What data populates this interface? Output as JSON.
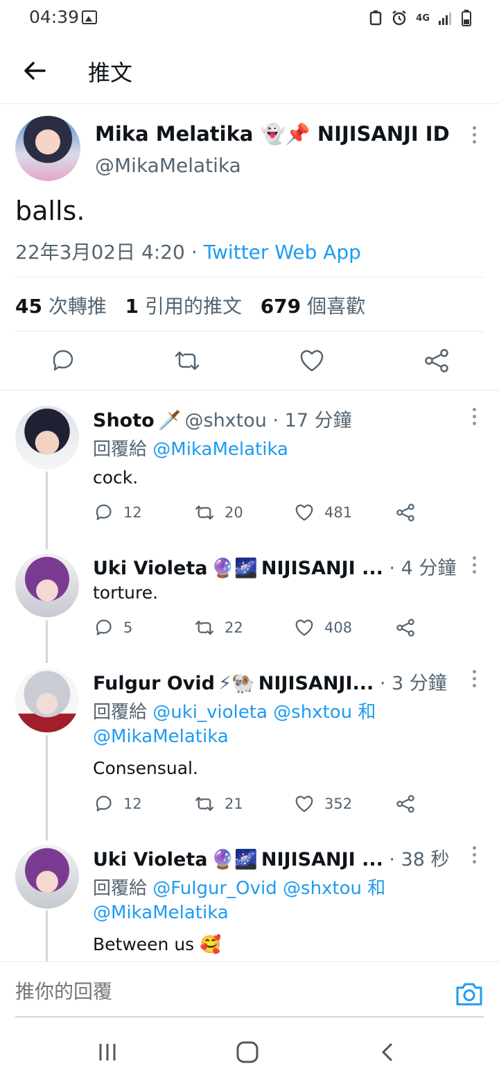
{
  "status": {
    "time": "04:39",
    "network": "4G"
  },
  "header": {
    "title": "推文"
  },
  "tweet": {
    "name": "Mika Melatika",
    "name_suffix": "NIJISANJI ID",
    "name_emoji": "👻📌",
    "handle": "@MikaMelatika",
    "text": "balls.",
    "date": "22年3月02日 4:20",
    "separator": " · ",
    "source": "Twitter Web App",
    "retweets": "45",
    "retweets_label": "次轉推",
    "quotes": "1",
    "quotes_label": "引用的推文",
    "likes": "679",
    "likes_label": "個喜歡"
  },
  "replies": [
    {
      "name": "Shoto",
      "emoji": "🗡️",
      "handle": "@shxtou",
      "time": " · 17 分鐘",
      "reply_prefix": "回覆給 ",
      "mentions_line1": "@MikaMelatika",
      "text": "cock.",
      "comments": "12",
      "retweets": "20",
      "likes": "481"
    },
    {
      "name": "Uki Violeta",
      "emoji": "🔮🌌",
      "suffix": "NIJISANJI ...",
      "time": " · 4 分鐘",
      "text": "torture.",
      "comments": "5",
      "retweets": "22",
      "likes": "408"
    },
    {
      "name": "Fulgur Ovid",
      "emoji": "⚡🐏",
      "suffix": "NIJISANJI...",
      "time": " · 3 分鐘",
      "reply_prefix": "回覆給 ",
      "mentions_line1": "@uki_violeta @shxtou 和",
      "mentions_line2": "@MikaMelatika",
      "text": "Consensual.",
      "comments": "12",
      "retweets": "21",
      "likes": "352"
    },
    {
      "name": "Uki Violeta",
      "emoji": "🔮🌌",
      "suffix": "NIJISANJI ...",
      "time": " · 38 秒",
      "reply_prefix": "回覆給 ",
      "mentions_line1": "@Fulgur_Ovid @shxtou 和",
      "mentions_line2": "@MikaMelatika",
      "text": "Between us 🥰"
    }
  ],
  "compose": {
    "placeholder": "推你的回覆"
  },
  "colors": {
    "accent": "#1d9bf0",
    "secondary_text": "#536471",
    "divider": "#e6e9ec"
  }
}
